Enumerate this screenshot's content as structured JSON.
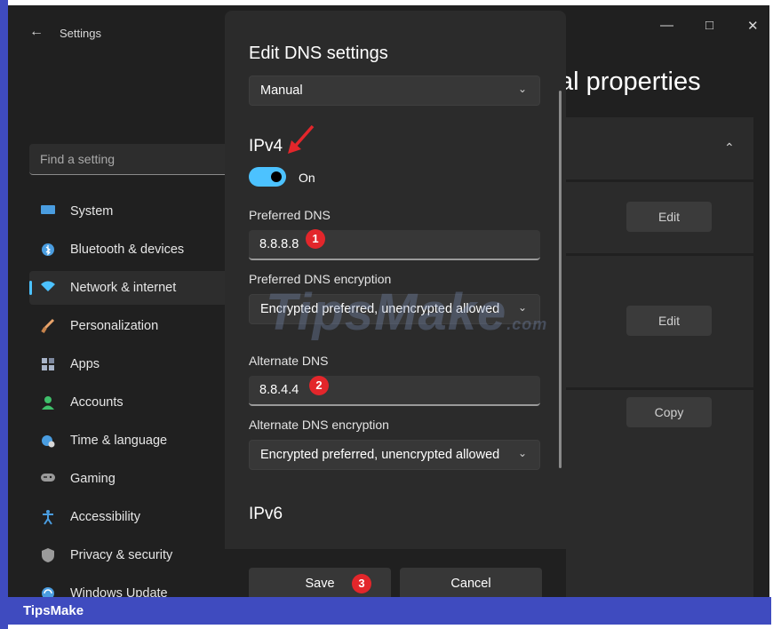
{
  "app": {
    "title": "Settings"
  },
  "search": {
    "placeholder": "Find a setting"
  },
  "nav": [
    {
      "label": "System",
      "icon": "monitor-icon",
      "color": "#4a9de0"
    },
    {
      "label": "Bluetooth & devices",
      "icon": "bluetooth-icon",
      "color": "#4a9de0"
    },
    {
      "label": "Network & internet",
      "icon": "wifi-icon",
      "color": "#4cc2ff",
      "active": true
    },
    {
      "label": "Personalization",
      "icon": "brush-icon",
      "color": "#e8a36a"
    },
    {
      "label": "Apps",
      "icon": "apps-icon",
      "color": "#a8b4c8"
    },
    {
      "label": "Accounts",
      "icon": "person-icon",
      "color": "#3fbf6a"
    },
    {
      "label": "Time & language",
      "icon": "globe-clock-icon",
      "color": "#4a9de0"
    },
    {
      "label": "Gaming",
      "icon": "gamepad-icon",
      "color": "#9a9a9a"
    },
    {
      "label": "Accessibility",
      "icon": "accessibility-icon",
      "color": "#4a9de0"
    },
    {
      "label": "Privacy & security",
      "icon": "shield-icon",
      "color": "#9a9a9a"
    },
    {
      "label": "Windows Update",
      "icon": "update-icon",
      "color": "#4a9de0"
    }
  ],
  "background": {
    "page_title": "al properties",
    "edit1": "Edit",
    "edit2": "Edit",
    "copy": "Copy"
  },
  "dialog": {
    "title": "Edit DNS settings",
    "mode": "Manual",
    "ipv4_heading": "IPv4",
    "toggle_label": "On",
    "preferred_dns_label": "Preferred DNS",
    "preferred_dns_value": "8.8.8.8",
    "preferred_enc_label": "Preferred DNS encryption",
    "preferred_enc_value": "Encrypted preferred, unencrypted allowed",
    "alternate_dns_label": "Alternate DNS",
    "alternate_dns_value": "8.8.4.4",
    "alternate_enc_label": "Alternate DNS encryption",
    "alternate_enc_value": "Encrypted preferred, unencrypted allowed",
    "ipv6_heading": "IPv6",
    "save_label": "Save",
    "cancel_label": "Cancel"
  },
  "annotations": {
    "badge1": "1",
    "badge2": "2",
    "badge3": "3"
  },
  "watermark": {
    "main": "TipsMake",
    "suffix": ".com"
  },
  "footer_brand": "TipsMake",
  "colors": {
    "accent": "#4cc2ff",
    "frame": "#3f4bbf",
    "badge": "#e3262b"
  }
}
